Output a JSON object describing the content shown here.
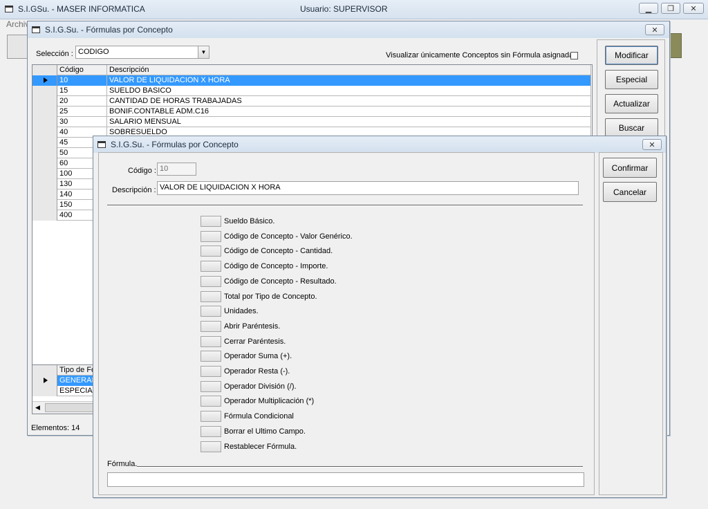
{
  "app": {
    "title": "S.I.GSu. - MASER INFORMATICA",
    "user": "Usuario: SUPERVISOR",
    "menu_first": "Archivo"
  },
  "main_dialog": {
    "title": "S.I.G.Su. - Fórmulas por Concepto",
    "seleccion_label": "Selección :",
    "seleccion_value": "CODIGO",
    "sin_formula_label": "Visualizar únicamente Conceptos sin Fórmula asignada",
    "grid_headers": [
      "Código",
      "Descripción"
    ],
    "rows": [
      {
        "codigo": "10",
        "descripcion": "VALOR DE LIQUIDACION X HORA"
      },
      {
        "codigo": "15",
        "descripcion": "SUELDO BASICO"
      },
      {
        "codigo": "20",
        "descripcion": "CANTIDAD DE HORAS TRABAJADAS"
      },
      {
        "codigo": "25",
        "descripcion": "BONIF.CONTABLE ADM.C16"
      },
      {
        "codigo": "30",
        "descripcion": "SALARIO MENSUAL"
      },
      {
        "codigo": "40",
        "descripcion": "SOBRESUELDO"
      },
      {
        "codigo": "45",
        "descripcion": ""
      },
      {
        "codigo": "50",
        "descripcion": ""
      },
      {
        "codigo": "60",
        "descripcion": ""
      },
      {
        "codigo": "100",
        "descripcion": ""
      },
      {
        "codigo": "130",
        "descripcion": ""
      },
      {
        "codigo": "140",
        "descripcion": ""
      },
      {
        "codigo": "150",
        "descripcion": ""
      },
      {
        "codigo": "400",
        "descripcion": ""
      }
    ],
    "tipo_header": "Tipo de Fó",
    "tipo_rows": [
      "GENERAL",
      "ESPECIAL"
    ],
    "elementos": "Elementos: 14",
    "buttons": {
      "modificar": "Modificar",
      "especial": "Especial",
      "actualizar": "Actualizar",
      "buscar": "Buscar"
    }
  },
  "formula_dialog": {
    "title": "S.I.G.Su. - Fórmulas por Concepto",
    "codigo_label": "Código :",
    "codigo_value": "10",
    "descripcion_label": "Descripción :",
    "descripcion_value": "VALOR DE LIQUIDACION X HORA",
    "items": [
      "Sueldo Básico.",
      "Código de Concepto - Valor Genérico.",
      "Código de Concepto - Cantidad.",
      "Código de Concepto - Importe.",
      "Código de Concepto - Resultado.",
      "Total por Tipo de Concepto.",
      "Unidades.",
      "Abrir Paréntesis.",
      "Cerrar Paréntesis.",
      "Operador Suma (+).",
      "Operador Resta (-).",
      "Operador División (/).",
      "Operador Multiplicación (*)",
      "Fórmula Condicional",
      "Borrar el Ultimo Campo.",
      "Restablecer Fórmula."
    ],
    "formula_label": "Fórmula.",
    "formula_value": "",
    "buttons": {
      "confirmar": "Confirmar",
      "cancelar": "Cancelar"
    }
  }
}
